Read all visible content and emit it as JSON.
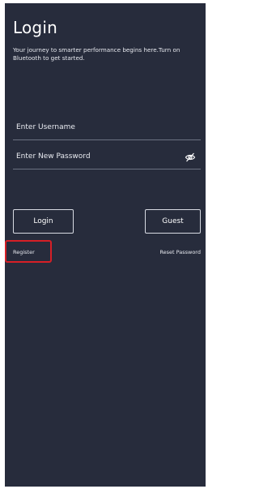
{
  "header": {
    "title": "Login",
    "subtitle": "Your journey to smarter performance begins here.Turn on Bluetooth to get started."
  },
  "form": {
    "username_placeholder": "Enter Username",
    "password_placeholder": "Enter New Password",
    "toggle_visibility_icon": "eye-slash-icon"
  },
  "buttons": {
    "login_label": "Login",
    "guest_label": "Guest"
  },
  "links": {
    "register_label": "Register",
    "reset_password_label": "Reset Password"
  },
  "colors": {
    "background": "#272c3c",
    "highlight": "#d61f26"
  }
}
